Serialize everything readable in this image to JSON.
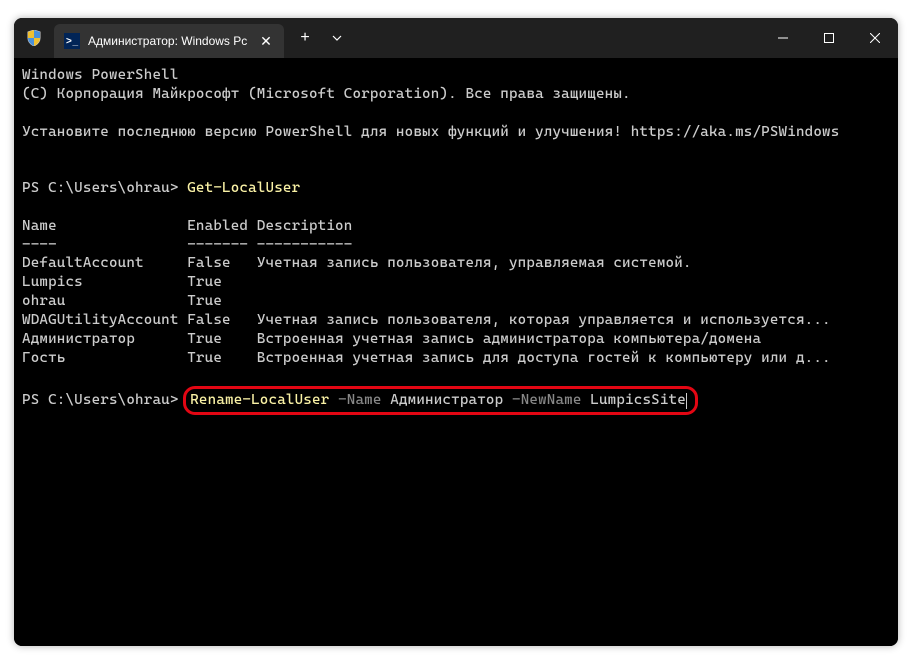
{
  "titleBar": {
    "tabTitle": "Администратор: Windows Pc"
  },
  "terminal": {
    "header1": "Windows PowerShell",
    "header2": "(C) Корпорация Майкрософт (Microsoft Corporation). Все права защищены.",
    "notice": "Установите последнюю версию PowerShell для новых функций и улучшения! https://aka.ms/PSWindows",
    "prompt1_prefix": "PS C:\\Users\\ohrau> ",
    "prompt1_cmd": "Get-LocalUser",
    "table": {
      "headers": {
        "name": "Name",
        "enabled": "Enabled",
        "description": "Description"
      },
      "dividers": {
        "name": "----",
        "enabled": "-------",
        "description": "-----------"
      },
      "rows": [
        {
          "name": "DefaultAccount",
          "enabled": "False",
          "description": "Учетная запись пользователя, управляемая системой."
        },
        {
          "name": "Lumpics",
          "enabled": "True",
          "description": ""
        },
        {
          "name": "ohrau",
          "enabled": "True",
          "description": ""
        },
        {
          "name": "WDAGUtilityAccount",
          "enabled": "False",
          "description": "Учетная запись пользователя, которая управляется и используется..."
        },
        {
          "name": "Администратор",
          "enabled": "True",
          "description": "Встроенная учетная запись администратора компьютера/домена"
        },
        {
          "name": "Гость",
          "enabled": "True",
          "description": "Встроенная учетная запись для доступа гостей к компьютеру или д..."
        }
      ]
    },
    "prompt2_prefix": "PS C:\\Users\\ohrau> ",
    "prompt2_cmd": "Rename-LocalUser",
    "prompt2_param1": " -Name",
    "prompt2_val1": " Администратор",
    "prompt2_param2": " -NewName",
    "prompt2_val2": " LumpicsSite"
  }
}
